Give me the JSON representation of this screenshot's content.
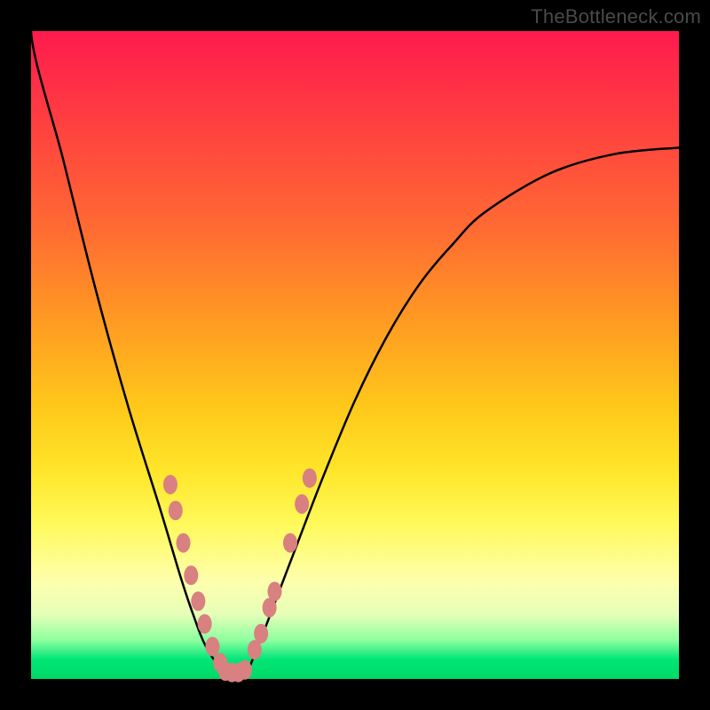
{
  "watermark": "TheBottleneck.com",
  "colors": {
    "frame": "#000000",
    "curve": "#000000",
    "marker_fill": "#d98080",
    "marker_stroke": "#b85a5a"
  },
  "chart_data": {
    "type": "line",
    "title": "",
    "xlabel": "",
    "ylabel": "",
    "xlim": [
      0,
      100
    ],
    "ylim": [
      0,
      100
    ],
    "x": [
      0,
      5,
      10,
      15,
      20,
      23,
      25,
      27,
      30,
      33,
      35,
      40,
      45,
      50,
      55,
      60,
      65,
      70,
      80,
      90,
      100
    ],
    "y": [
      100,
      80,
      60,
      42,
      26,
      16,
      10,
      5,
      1,
      1,
      5,
      18,
      31,
      43,
      53,
      61,
      67,
      72,
      78,
      81,
      82
    ],
    "series": [
      {
        "name": "bottleneck-curve",
        "note": "V-shaped black curve; minimum near x≈31; y measured as % of plot height from bottom"
      }
    ],
    "markers_left": [
      {
        "x": 21.5,
        "y": 30
      },
      {
        "x": 22.3,
        "y": 26
      },
      {
        "x": 23.5,
        "y": 21
      },
      {
        "x": 24.7,
        "y": 16
      },
      {
        "x": 25.8,
        "y": 12
      },
      {
        "x": 26.8,
        "y": 8.5
      },
      {
        "x": 28.0,
        "y": 5
      },
      {
        "x": 29.2,
        "y": 2.5
      }
    ],
    "markers_bottom": [
      {
        "x": 30.0,
        "y": 1.2
      },
      {
        "x": 31.0,
        "y": 1.0
      },
      {
        "x": 32.0,
        "y": 1.0
      },
      {
        "x": 33.0,
        "y": 1.4
      }
    ],
    "markers_right": [
      {
        "x": 34.5,
        "y": 4.5
      },
      {
        "x": 35.5,
        "y": 7
      },
      {
        "x": 36.8,
        "y": 11
      },
      {
        "x": 37.6,
        "y": 13.5
      },
      {
        "x": 40.0,
        "y": 21
      },
      {
        "x": 41.8,
        "y": 27
      },
      {
        "x": 43.0,
        "y": 31
      }
    ]
  }
}
